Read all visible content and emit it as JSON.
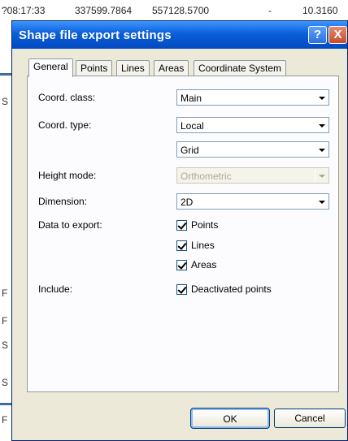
{
  "background": {
    "row_values": [
      "?08:17:33",
      "337599.7864",
      "557128.5700",
      "-",
      "10.3160"
    ],
    "left_letters": [
      "S",
      "F",
      "F",
      "S",
      "S",
      "F"
    ]
  },
  "dialog": {
    "title": "Shape file export settings",
    "help_glyph": "?",
    "close_glyph": "X",
    "tabs": [
      "General",
      "Points",
      "Lines",
      "Areas",
      "Coordinate System"
    ],
    "active_tab": "General",
    "fields": {
      "coord_class": {
        "label": "Coord. class:",
        "value": "Main"
      },
      "coord_type": {
        "label": "Coord. type:",
        "value": "Local"
      },
      "coord_sub": {
        "value": "Grid"
      },
      "height_mode": {
        "label": "Height mode:",
        "value": "Orthometric",
        "disabled": true
      },
      "dimension": {
        "label": "Dimension:",
        "value": "2D"
      }
    },
    "data_to_export": {
      "label": "Data to export:",
      "items": [
        {
          "label": "Points",
          "checked": true
        },
        {
          "label": "Lines",
          "checked": true
        },
        {
          "label": "Areas",
          "checked": true
        }
      ]
    },
    "include": {
      "label": "Include:",
      "items": [
        {
          "label": "Deactivated points",
          "checked": true
        }
      ]
    },
    "buttons": {
      "ok": "OK",
      "cancel": "Cancel"
    }
  }
}
